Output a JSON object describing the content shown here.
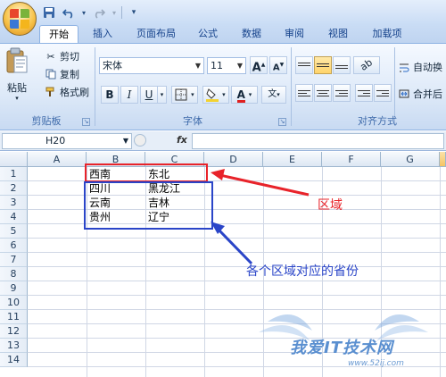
{
  "qat": {
    "save": "save-icon",
    "undo": "undo-icon",
    "redo": "redo-icon"
  },
  "tabs": [
    "开始",
    "插入",
    "页面布局",
    "公式",
    "数据",
    "审阅",
    "视图",
    "加载项"
  ],
  "clipboard": {
    "paste": "粘贴",
    "cut": "剪切",
    "copy": "复制",
    "format_painter": "格式刷",
    "group": "剪贴板"
  },
  "font": {
    "name": "宋体",
    "size": "11",
    "grow": "A",
    "shrink": "A",
    "bold": "B",
    "italic": "I",
    "underline": "U",
    "color_letter": "A",
    "phonetic": "文",
    "group": "字体",
    "fill_color": "#f3d230",
    "font_color": "#e02020"
  },
  "alignment": {
    "wrap": "自动换",
    "merge": "合并后",
    "group": "对齐方式"
  },
  "formula_bar": {
    "name_box": "H20",
    "fx": "fx",
    "value": ""
  },
  "columns": [
    "A",
    "B",
    "C",
    "D",
    "E",
    "F",
    "G"
  ],
  "rows": [
    "1",
    "2",
    "3",
    "4",
    "5",
    "6",
    "7",
    "8",
    "9",
    "10",
    "11",
    "12",
    "13",
    "14"
  ],
  "cells": {
    "B1": "西南",
    "C1": "东北",
    "B2": "四川",
    "C2": "黑龙江",
    "B3": "云南",
    "C3": "吉林",
    "B4": "贵州",
    "C4": "辽宁"
  },
  "annotations": {
    "red_label": "区域",
    "blue_label": "各个区域对应的省份",
    "red_color": "#e8232a",
    "blue_color": "#2a45c8"
  },
  "watermark": {
    "text": "我爱IT技术网",
    "url": "www.52ij.com"
  }
}
